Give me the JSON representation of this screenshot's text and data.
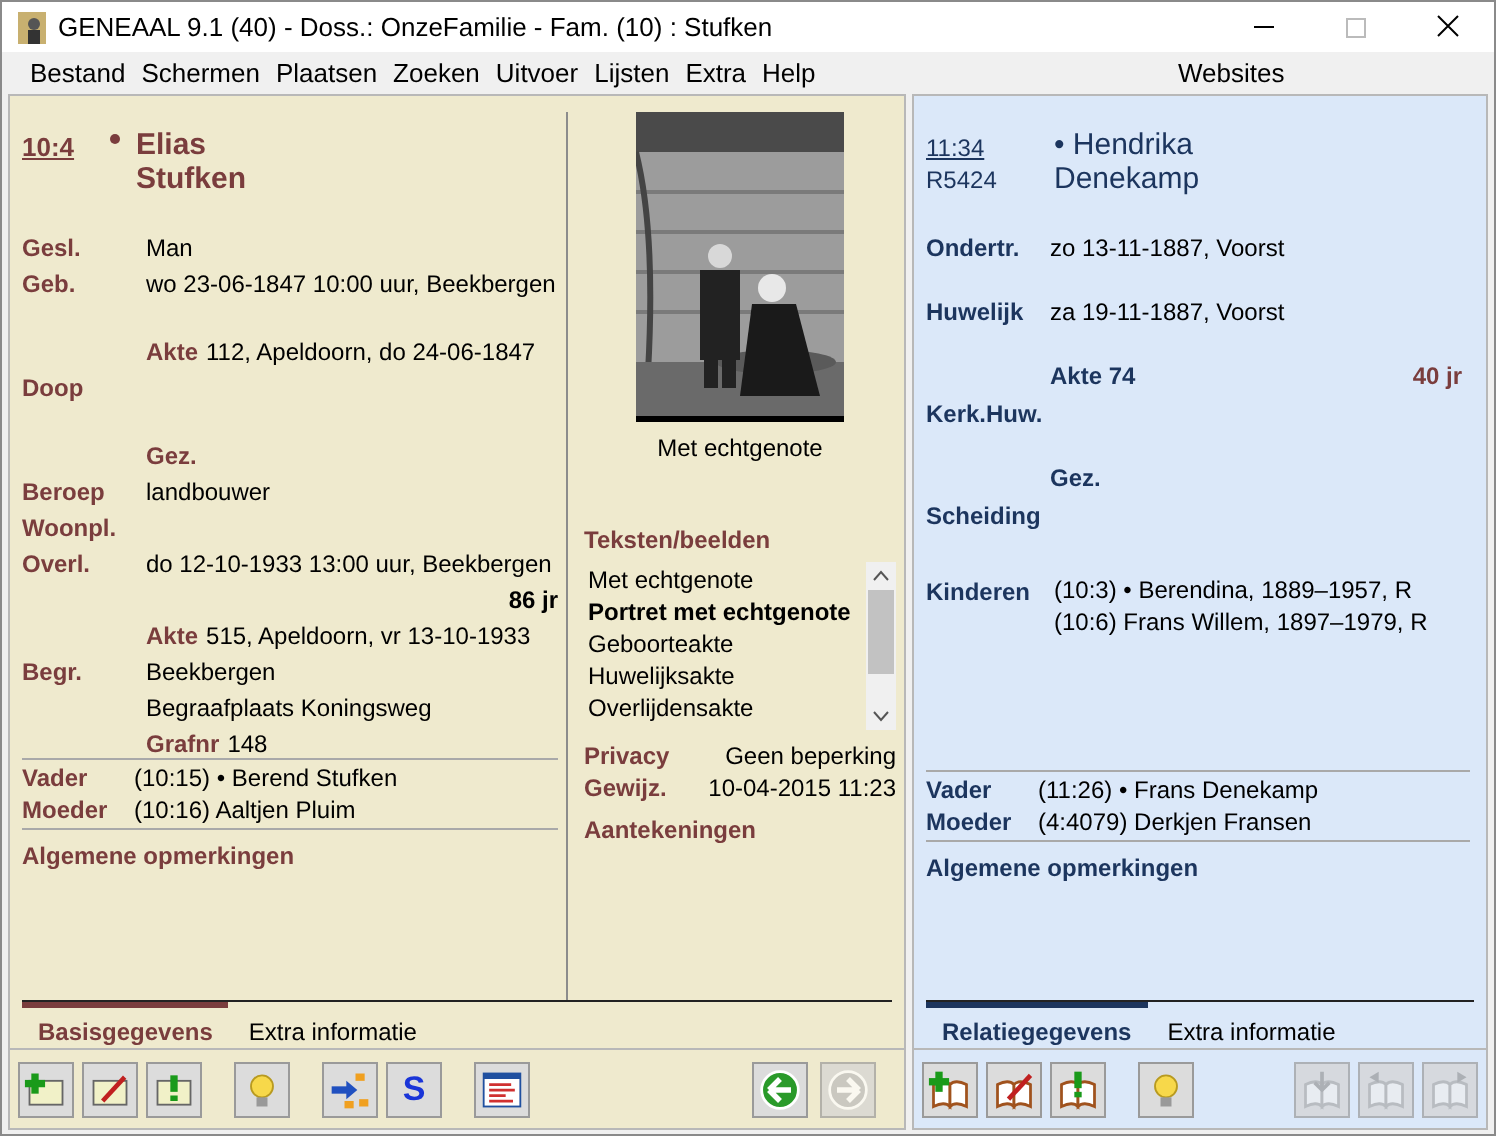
{
  "window": {
    "title": "GENEAAL 9.1 (40) - Doss.: OnzeFamilie - Fam. (10) : Stufken"
  },
  "menu": [
    "Bestand",
    "Schermen",
    "Plaatsen",
    "Zoeken",
    "Uitvoer",
    "Lijsten",
    "Extra",
    "Help"
  ],
  "websites": "Websites",
  "person": {
    "id": "10:4",
    "first_name": "Elias",
    "last_name": "Stufken",
    "facts": [
      {
        "kind": "fact",
        "label": "Gesl.",
        "value": "Man"
      },
      {
        "kind": "fact",
        "label": "Geb.",
        "value": "wo 23-06-1847 10:00 uur, Beekbergen"
      },
      {
        "kind": "sub",
        "spaced": true,
        "label": "Akte",
        "value": "112, Apeldoorn, do 24-06-1847"
      },
      {
        "kind": "fact",
        "label": "Doop"
      },
      {
        "kind": "sub",
        "spaced": true,
        "label": "Gez."
      },
      {
        "kind": "fact",
        "label": "Beroep",
        "value": "landbouwer"
      },
      {
        "kind": "fact",
        "label": "Woonpl."
      },
      {
        "kind": "fact",
        "label": "Overl.",
        "value": "do 12-10-1933 13:00 uur, Beekbergen"
      },
      {
        "kind": "age",
        "value": "86 jr"
      },
      {
        "kind": "sub",
        "label": "Akte",
        "value": "515, Apeldoorn, vr 13-10-1933"
      },
      {
        "kind": "fact",
        "label": "Begr.",
        "value": "Beekbergen"
      },
      {
        "kind": "cont",
        "value": "Begraafplaats Koningsweg"
      },
      {
        "kind": "sub",
        "label": "Grafnr",
        "value": "148"
      }
    ],
    "parents": [
      {
        "label": "Vader",
        "value": "(10:15) • Berend Stufken"
      },
      {
        "label": "Moeder",
        "value": "(10:16) Aaltjen Pluim"
      }
    ],
    "remarks": "Algemene opmerkingen"
  },
  "media": {
    "caption": "Met echtgenote",
    "heading": "Teksten/beelden",
    "items": [
      {
        "label": "Met echtgenote",
        "selected": false
      },
      {
        "label": "Portret met echtgenote",
        "selected": true
      },
      {
        "label": "Geboorteakte",
        "selected": false
      },
      {
        "label": "Huwelijksakte",
        "selected": false
      },
      {
        "label": "Overlijdensakte",
        "selected": false
      }
    ],
    "privacy": {
      "label": "Privacy",
      "value": "Geen beperking"
    },
    "modified": {
      "label": "Gewijz.",
      "value": "10-04-2015 11:23"
    },
    "notes": "Aantekeningen"
  },
  "partner": {
    "id": "11:34",
    "ref": "R5424",
    "first_name": "• Hendrika",
    "last_name": "Denekamp",
    "facts": [
      {
        "kind": "fact",
        "label": "Ondertr.",
        "value": "zo 13-11-1887, Voorst"
      },
      {
        "kind": "fact",
        "spaced": true,
        "label": "Huwelijk",
        "value": "za 19-11-1887, Voorst"
      },
      {
        "kind": "sub",
        "spaced": true,
        "label": "Akte 74",
        "value": "40 jr"
      },
      {
        "kind": "fact",
        "label": "Kerk.Huw."
      },
      {
        "kind": "sub",
        "spaced": true,
        "label": "Gez."
      },
      {
        "kind": "fact",
        "label": "Scheiding"
      }
    ],
    "children_label": "Kinderen",
    "children": [
      "(10:3) • Berendina, 1889–1957, R",
      "(10:6) Frans Willem, 1897–1979, R"
    ],
    "parents": [
      {
        "label": "Vader",
        "value": "(11:26) • Frans Denekamp"
      },
      {
        "label": "Moeder",
        "value": "(4:4079) Derkjen Fransen"
      }
    ],
    "remarks": "Algemene opmerkingen"
  },
  "left_tabs": [
    {
      "label": "Basisgegevens",
      "selected": true
    },
    {
      "label": "Extra informatie",
      "selected": false
    }
  ],
  "right_tabs": [
    {
      "label": "Relatiegegevens",
      "selected": true
    },
    {
      "label": "Extra informatie",
      "selected": false
    }
  ],
  "left_toolbar": [
    {
      "kind": "add"
    },
    {
      "kind": "edit"
    },
    {
      "kind": "warn"
    },
    {
      "kind": "hint"
    },
    {
      "kind": "tree"
    },
    {
      "kind": "letter",
      "text": "S"
    },
    {
      "kind": "list"
    }
  ],
  "left_nav": [
    {
      "kind": "back",
      "disabled": false
    },
    {
      "kind": "forward",
      "disabled": true
    }
  ],
  "right_toolbar": [
    {
      "kind": "book-add"
    },
    {
      "kind": "book-edit"
    },
    {
      "kind": "book-warn"
    },
    {
      "kind": "hint"
    }
  ],
  "right_nav": [
    {
      "kind": "book-down",
      "disabled": true
    },
    {
      "kind": "book-left",
      "disabled": true
    },
    {
      "kind": "book-right",
      "disabled": true
    }
  ]
}
